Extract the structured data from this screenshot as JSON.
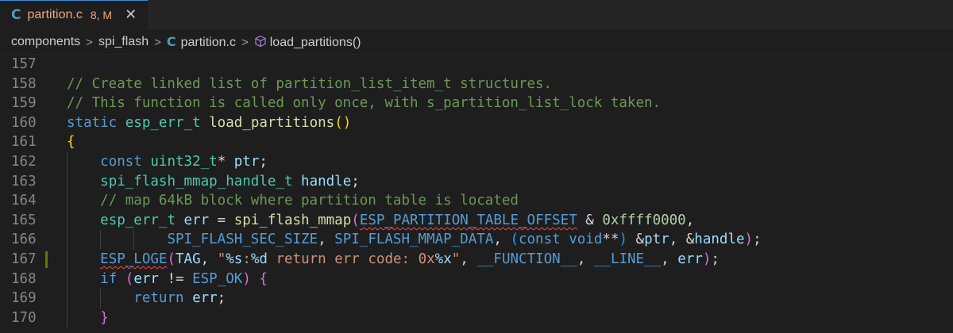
{
  "tab": {
    "icon": "C",
    "title": "partition.c",
    "status": "8, M",
    "close": "✕"
  },
  "breadcrumb": {
    "items": [
      "components",
      "spi_flash",
      "partition.c",
      "load_partitions()"
    ],
    "file_icon": "C"
  },
  "editor": {
    "lines": [
      {
        "n": "157",
        "parts": []
      },
      {
        "n": "158",
        "parts": [
          [
            "cm",
            "// Create linked list of partition_list_item_t structures."
          ]
        ]
      },
      {
        "n": "159",
        "parts": [
          [
            "cm",
            "// This function is called only once, with s_partition_list_lock taken."
          ]
        ]
      },
      {
        "n": "160",
        "parts": [
          [
            "kw",
            "static"
          ],
          [
            "pl",
            " "
          ],
          [
            "ty",
            "esp_err_t"
          ],
          [
            "pl",
            " "
          ],
          [
            "fn",
            "load_partitions"
          ],
          [
            "br1",
            "()"
          ]
        ]
      },
      {
        "n": "161",
        "parts": [
          [
            "br1",
            "{"
          ]
        ]
      },
      {
        "n": "162",
        "parts": [
          [
            "pl",
            "    "
          ],
          [
            "kw",
            "const"
          ],
          [
            "pl",
            " "
          ],
          [
            "ty",
            "uint32_t"
          ],
          [
            "pl",
            "* "
          ],
          [
            "id",
            "ptr"
          ],
          [
            "pl",
            ";"
          ]
        ]
      },
      {
        "n": "163",
        "parts": [
          [
            "pl",
            "    "
          ],
          [
            "ty",
            "spi_flash_mmap_handle_t"
          ],
          [
            "pl",
            " "
          ],
          [
            "id",
            "handle"
          ],
          [
            "pl",
            ";"
          ]
        ]
      },
      {
        "n": "164",
        "parts": [
          [
            "pl",
            "    "
          ],
          [
            "cm",
            "// map 64kB block where partition table is located"
          ]
        ]
      },
      {
        "n": "165",
        "parts": [
          [
            "pl",
            "    "
          ],
          [
            "ty",
            "esp_err_t"
          ],
          [
            "pl",
            " "
          ],
          [
            "id",
            "err"
          ],
          [
            "pl",
            " = "
          ],
          [
            "fn",
            "spi_flash_mmap"
          ],
          [
            "br2",
            "("
          ],
          [
            "mac squig",
            "ESP_PARTITION_TABLE_OFFSET"
          ],
          [
            "pl",
            " & "
          ],
          [
            "num",
            "0xffff0000"
          ],
          [
            "pl",
            ","
          ]
        ]
      },
      {
        "n": "166",
        "parts": [
          [
            "pl",
            "            "
          ],
          [
            "mac",
            "SPI_FLASH_SEC_SIZE"
          ],
          [
            "pl",
            ", "
          ],
          [
            "mac",
            "SPI_FLASH_MMAP_DATA"
          ],
          [
            "pl",
            ", "
          ],
          [
            "br3",
            "("
          ],
          [
            "kw",
            "const"
          ],
          [
            "pl",
            " "
          ],
          [
            "kw",
            "void"
          ],
          [
            "pl",
            "**"
          ],
          [
            "br3",
            ")"
          ],
          [
            "pl",
            " &"
          ],
          [
            "id",
            "ptr"
          ],
          [
            "pl",
            ", &"
          ],
          [
            "id",
            "handle"
          ],
          [
            "br2",
            ")"
          ],
          [
            "pl",
            ";"
          ]
        ]
      },
      {
        "n": "167",
        "parts": [
          [
            "pl",
            "    "
          ],
          [
            "mac squig",
            "ESP_LOGE"
          ],
          [
            "br2",
            "("
          ],
          [
            "id",
            "TAG"
          ],
          [
            "pl",
            ", "
          ],
          [
            "str",
            "\""
          ],
          [
            "fmt",
            "%s"
          ],
          [
            "str",
            ":"
          ],
          [
            "fmt",
            "%d"
          ],
          [
            "str",
            " return err code: 0x"
          ],
          [
            "fmt",
            "%x"
          ],
          [
            "str",
            "\""
          ],
          [
            "pl",
            ", "
          ],
          [
            "mac",
            "__FUNCTION__"
          ],
          [
            "pl",
            ", "
          ],
          [
            "mac",
            "__LINE__"
          ],
          [
            "pl",
            ", "
          ],
          [
            "id",
            "err"
          ],
          [
            "br2",
            ")"
          ],
          [
            "pl",
            ";"
          ]
        ]
      },
      {
        "n": "168",
        "parts": [
          [
            "pl",
            "    "
          ],
          [
            "kw",
            "if"
          ],
          [
            "pl",
            " "
          ],
          [
            "br2",
            "("
          ],
          [
            "id",
            "err"
          ],
          [
            "pl",
            " != "
          ],
          [
            "mac",
            "ESP_OK"
          ],
          [
            "br2",
            ")"
          ],
          [
            "pl",
            " "
          ],
          [
            "br2",
            "{"
          ]
        ]
      },
      {
        "n": "169",
        "parts": [
          [
            "pl",
            "        "
          ],
          [
            "kw",
            "return"
          ],
          [
            "pl",
            " "
          ],
          [
            "id",
            "err"
          ],
          [
            "pl",
            ";"
          ]
        ]
      },
      {
        "n": "170",
        "parts": [
          [
            "pl",
            "    "
          ],
          [
            "br2",
            "}"
          ]
        ]
      }
    ]
  }
}
